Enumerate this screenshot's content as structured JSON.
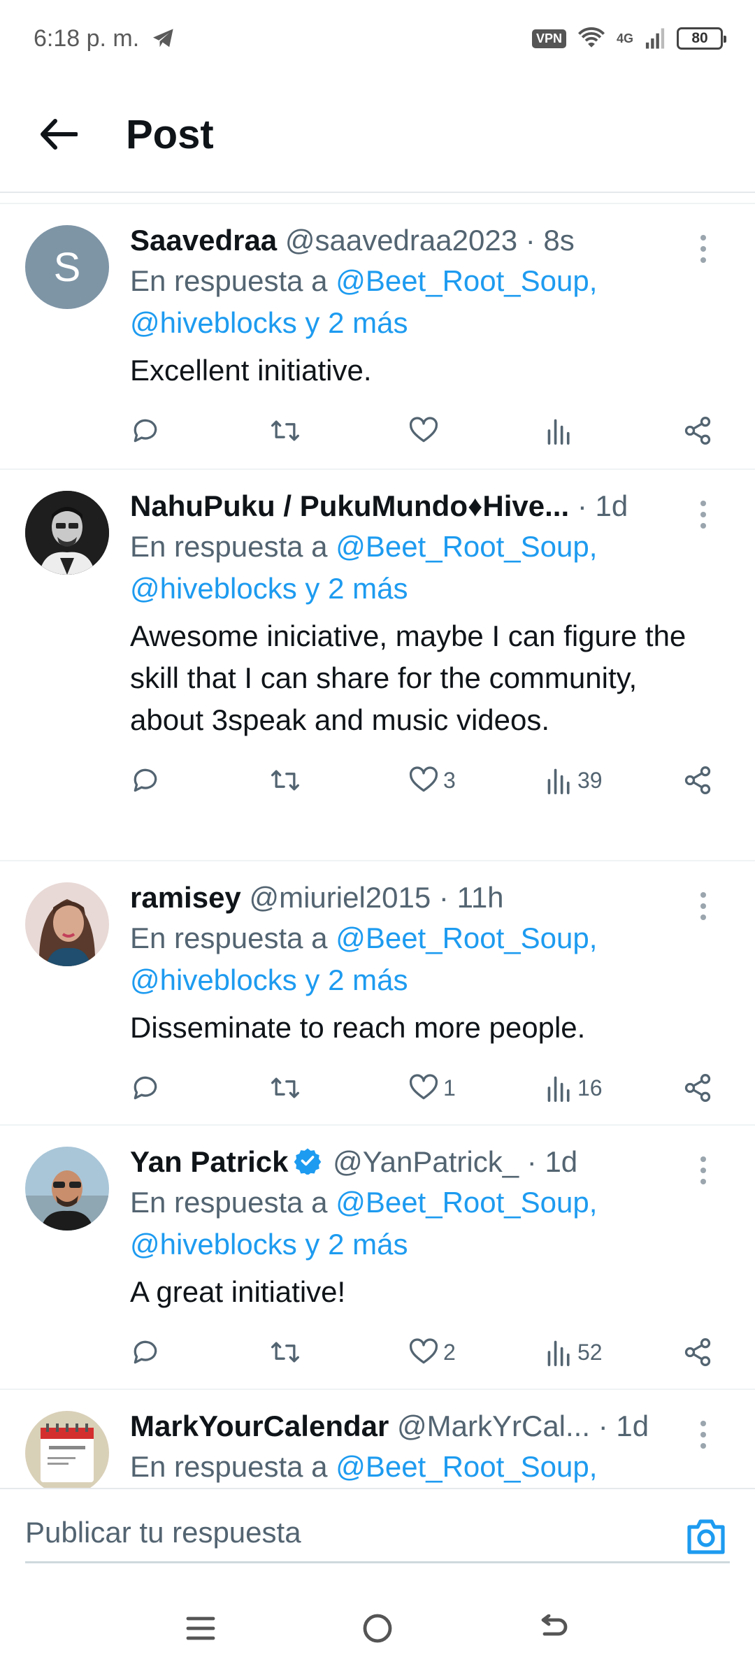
{
  "status_bar": {
    "time": "6:18 p. m.",
    "vpn": "VPN",
    "network": "4G",
    "battery": "80"
  },
  "header": {
    "title": "Post"
  },
  "replies": [
    {
      "name": "Saavedraa",
      "handle": "@saavedraa2023",
      "time": "8s",
      "verified": false,
      "avatar_letter": "S",
      "reply_prefix": "En respuesta a",
      "reply_mentions": "@Beet_Root_Soup, @hiveblocks y 2 más",
      "text": "Excellent initiative.",
      "likes": "",
      "views": ""
    },
    {
      "name": "NahuPuku / PukuMundo♦Hive...",
      "handle": "",
      "time": "1d",
      "verified": false,
      "reply_prefix": "En respuesta a",
      "reply_mentions": "@Beet_Root_Soup, @hiveblocks y 2 más",
      "text": "Awesome iniciative, maybe I can figure the skill that I can share for the community, about 3speak and music videos.",
      "likes": "3",
      "views": "39"
    },
    {
      "name": "ramisey",
      "handle": "@miuriel2015",
      "time": "11h",
      "verified": false,
      "reply_prefix": "En respuesta a",
      "reply_mentions": "@Beet_Root_Soup, @hiveblocks y 2 más",
      "text": "Disseminate to reach more people.",
      "likes": "1",
      "views": "16"
    },
    {
      "name": "Yan Patrick",
      "handle": "@YanPatrick_",
      "time": "1d",
      "verified": true,
      "reply_prefix": "En respuesta a",
      "reply_mentions": "@Beet_Root_Soup, @hiveblocks y 2 más",
      "text": "A great initiative!",
      "likes": "2",
      "views": "52"
    },
    {
      "name": "MarkYourCalendar",
      "handle": "@MarkYrCal...",
      "time": "1d",
      "verified": false,
      "reply_prefix": "En respuesta a",
      "reply_mentions": "@Beet_Root_Soup,",
      "text": "",
      "likes": "",
      "views": ""
    }
  ],
  "compose": {
    "placeholder": "Publicar tu respuesta"
  },
  "colors": {
    "accent": "#1d9bf0",
    "muted": "#536471",
    "text": "#0f1419"
  }
}
